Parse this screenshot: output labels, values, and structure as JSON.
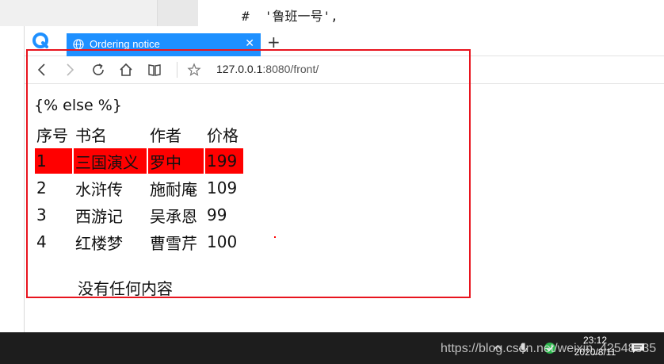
{
  "editor": {
    "code_line": "#  '鲁班一号',"
  },
  "browser": {
    "tab_title": "Ordering notice",
    "new_tab_label": "+",
    "url_host": "127.0.0.1",
    "url_rest": ":8080/front/"
  },
  "page": {
    "raw_template_text": "{% else %}",
    "table": {
      "headers": [
        "序号",
        "书名",
        "作者",
        "价格"
      ],
      "rows": [
        {
          "id": "1",
          "title": "三国演义",
          "author": "罗中",
          "price": "199",
          "highlighted": true
        },
        {
          "id": "2",
          "title": "水浒传",
          "author": "施耐庵",
          "price": "109",
          "highlighted": false
        },
        {
          "id": "3",
          "title": "西游记",
          "author": "吴承恩",
          "price": "99",
          "highlighted": false
        },
        {
          "id": "4",
          "title": "红楼梦",
          "author": "曹雪芹",
          "price": "100",
          "highlighted": false
        }
      ]
    },
    "empty_text": "没有任何内容"
  },
  "taskbar": {
    "time": "23:12",
    "date": "2020/8/11",
    "watermark": "https://blog.csdn.net/weixin_42548335"
  },
  "colors": {
    "tab_accent": "#1e90ff",
    "row_highlight": "#ff0000",
    "annotation": "#e8141e",
    "taskbar": "#1d1d1d"
  },
  "icons": [
    "browser-logo-icon",
    "globe-icon",
    "close-icon",
    "back-icon",
    "forward-icon",
    "reload-icon",
    "home-icon",
    "reader-icon",
    "star-icon",
    "chevron-up-icon",
    "microphone-icon",
    "app-tray-icon",
    "notification-icon"
  ]
}
